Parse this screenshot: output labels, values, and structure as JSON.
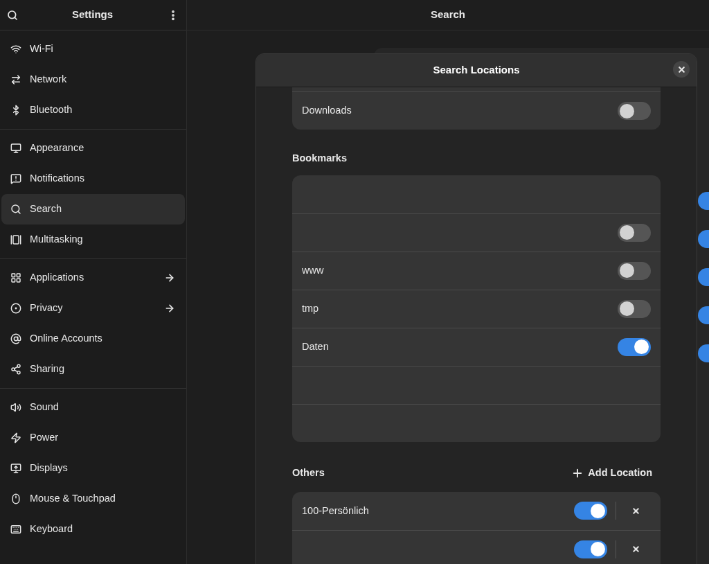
{
  "sidebar": {
    "title": "Settings",
    "groups": [
      [
        {
          "label": "Wi-Fi",
          "selected": false,
          "arrow": false
        },
        {
          "label": "Network",
          "selected": false,
          "arrow": false
        },
        {
          "label": "Bluetooth",
          "selected": false,
          "arrow": false
        }
      ],
      [
        {
          "label": "Appearance",
          "selected": false,
          "arrow": false
        },
        {
          "label": "Notifications",
          "selected": false,
          "arrow": false
        },
        {
          "label": "Search",
          "selected": true,
          "arrow": false
        },
        {
          "label": "Multitasking",
          "selected": false,
          "arrow": false
        }
      ],
      [
        {
          "label": "Applications",
          "selected": false,
          "arrow": true
        },
        {
          "label": "Privacy",
          "selected": false,
          "arrow": true
        },
        {
          "label": "Online Accounts",
          "selected": false,
          "arrow": false
        },
        {
          "label": "Sharing",
          "selected": false,
          "arrow": false
        }
      ],
      [
        {
          "label": "Sound",
          "selected": false,
          "arrow": false
        },
        {
          "label": "Power",
          "selected": false,
          "arrow": false
        },
        {
          "label": "Displays",
          "selected": false,
          "arrow": false
        },
        {
          "label": "Mouse & Touchpad",
          "selected": false,
          "arrow": false
        },
        {
          "label": "Keyboard",
          "selected": false,
          "arrow": false
        }
      ]
    ]
  },
  "main": {
    "title": "Search",
    "background_switches": [
      {
        "on": true
      },
      {
        "on": true
      },
      {
        "on": true
      },
      {
        "on": true
      },
      {
        "on": true
      }
    ]
  },
  "dialog": {
    "title": "Search Locations",
    "places": [
      {
        "label": "Downloads",
        "on": false
      }
    ],
    "bookmarks": {
      "heading": "Bookmarks",
      "rows": [
        {},
        {
          "on": false
        },
        {
          "label": "www",
          "on": false
        },
        {
          "label": "tmp",
          "on": false
        },
        {
          "label": "Daten",
          "on": true
        },
        {},
        {}
      ]
    },
    "others": {
      "heading": "Others",
      "add_label": "Add Location",
      "rows": [
        {
          "label": "100-Persönlich",
          "on": true
        },
        {
          "on": true
        }
      ]
    }
  }
}
